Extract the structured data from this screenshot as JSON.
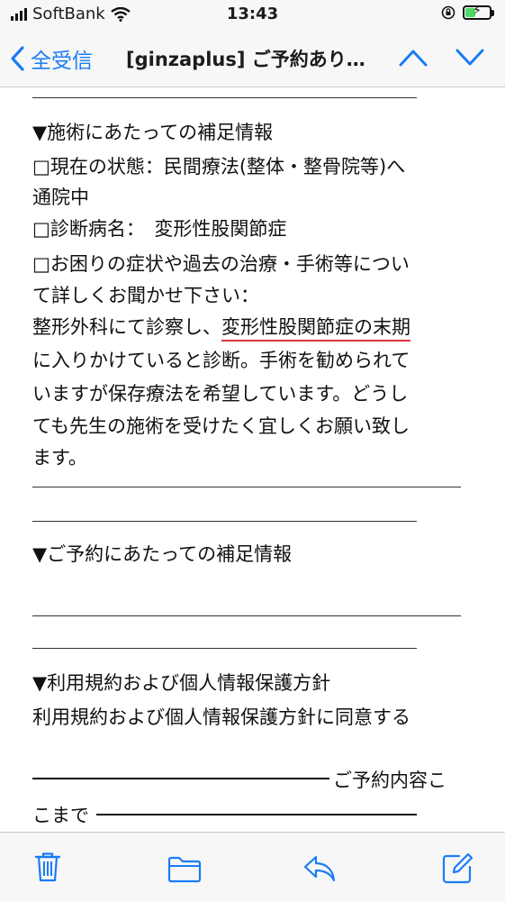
{
  "status": {
    "carrier": "SoftBank",
    "time": "13:43"
  },
  "nav": {
    "back_label": "全受信",
    "title": "[ginzaplus] ご予約あり…"
  },
  "body": {
    "section1_heading": "▼施術にあたっての補足情報",
    "condition_line1": "□現在の状態：民間療法(整体・整骨院等)へ",
    "condition_line2": "通院中",
    "diagnosis": "□診断病名：　変形性股関節症",
    "symptoms_line1": "□お困りの症状や過去の治療・手術等につい",
    "symptoms_line2": "て詳しくお聞かせ下さい：",
    "detail_line1_a": "整形外科にて診察し、",
    "detail_line1_highlight": "変形性股関節症の末期",
    "detail_line2": "に入りかけていると診断。手術を勧められて",
    "detail_line3": "いますが保存療法を希望しています。どうし",
    "detail_line4": "ても先生の施術を受けたく宜しくお願い致し",
    "detail_line5": "ます。",
    "section2_heading": "▼ご予約にあたっての補足情報",
    "section3_heading": "▼利用規約および個人情報保護方針",
    "consent": "利用規約および個人情報保護方針に同意する",
    "end_marker_a": "ご予約内容こ",
    "end_marker_b": "こまで"
  },
  "colors": {
    "accent": "#1a7cf5",
    "highlight_underline": "#e0383e",
    "battery_charge": "#4cd964"
  },
  "icons": {
    "toolbar": [
      "trash-icon",
      "folder-icon",
      "reply-icon",
      "compose-icon"
    ],
    "nav": [
      "chevron-left-icon",
      "chevron-up-icon",
      "chevron-down-icon"
    ]
  }
}
